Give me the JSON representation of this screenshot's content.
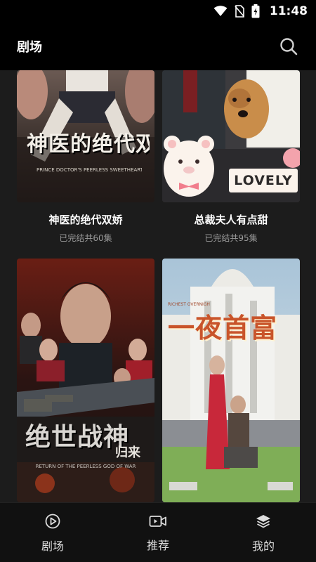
{
  "status_bar": {
    "time": "11:48",
    "icons": [
      "wifi-icon",
      "no-sim-icon",
      "battery-charging-icon"
    ]
  },
  "header": {
    "title": "剧场",
    "search_icon": "search-icon"
  },
  "dramas": [
    {
      "title": "神医的绝代双娇",
      "status": "已完结共60集",
      "poster_title": "神医的绝代双娇",
      "poster_subtitle": "PRINCE DOCTOR'S PEERLESS SWEETHEARTS"
    },
    {
      "title": "总裁夫人有点甜",
      "status": "已完结共95集",
      "poster_badge": "LOVELY"
    },
    {
      "title": "绝世战神归来",
      "poster_title": "绝世战神",
      "poster_title_small": "归来",
      "poster_subtitle": "RETURN OF THE PEERLESS GOD OF WAR"
    },
    {
      "title": "一夜首富",
      "poster_title": "一夜首富",
      "poster_subtitle": "RICHEST OVERNIGHT"
    }
  ],
  "bottom_nav": [
    {
      "label": "剧场",
      "icon": "play-circle-icon"
    },
    {
      "label": "推荐",
      "icon": "video-camera-icon"
    },
    {
      "label": "我的",
      "icon": "layers-icon"
    }
  ],
  "colors": {
    "background": "#1c1c1c",
    "bar": "#000000",
    "nav": "#111111",
    "muted_text": "#9a9a9a"
  }
}
